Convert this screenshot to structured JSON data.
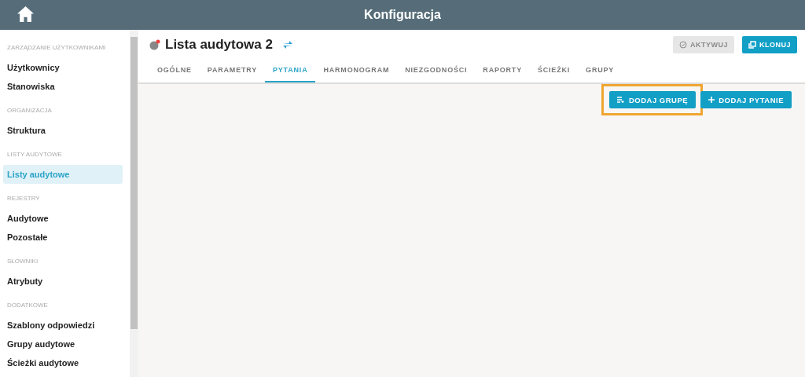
{
  "header": {
    "title": "Konfiguracja"
  },
  "sidebar": {
    "sections": [
      {
        "heading": "ZARZĄDZANIE UŻYTKOWNIKAMI",
        "items": [
          {
            "label": "Użytkownicy",
            "selected": false
          },
          {
            "label": "Stanowiska",
            "selected": false
          }
        ]
      },
      {
        "heading": "ORGANIZACJA",
        "items": [
          {
            "label": "Struktura",
            "selected": false
          }
        ]
      },
      {
        "heading": "LISTY AUDYTOWE",
        "items": [
          {
            "label": "Listy audytowe",
            "selected": true
          }
        ]
      },
      {
        "heading": "REJESTRY",
        "items": [
          {
            "label": "Audytowe",
            "selected": false
          },
          {
            "label": "Pozostałe",
            "selected": false
          }
        ]
      },
      {
        "heading": "SŁOWNIKI",
        "items": [
          {
            "label": "Atrybuty",
            "selected": false
          }
        ]
      },
      {
        "heading": "DODATKOWE",
        "items": [
          {
            "label": "Szablony odpowiedzi",
            "selected": false
          },
          {
            "label": "Grupy audytowe",
            "selected": false
          },
          {
            "label": "Ścieżki audytowe",
            "selected": false
          }
        ]
      }
    ]
  },
  "page": {
    "title": "Lista audytowa 2",
    "actions": [
      {
        "label": "AKTYWUJ",
        "kind": "activate",
        "disabled": true
      },
      {
        "label": "KLONUJ",
        "kind": "clone",
        "disabled": false
      }
    ]
  },
  "tabs": [
    {
      "label": "OGÓLNE",
      "selected": false
    },
    {
      "label": "PARAMETRY",
      "selected": false
    },
    {
      "label": "PYTANIA",
      "selected": true
    },
    {
      "label": "HARMONOGRAM",
      "selected": false
    },
    {
      "label": "NIEZGODNOŚCI",
      "selected": false
    },
    {
      "label": "RAPORTY",
      "selected": false
    },
    {
      "label": "ŚCIEŻKI",
      "selected": false
    },
    {
      "label": "GRUPY",
      "selected": false
    }
  ],
  "toolbar": [
    {
      "label": "DODAJ GRUPĘ",
      "kind": "add-group",
      "highlighted": true
    },
    {
      "label": "DODAJ PYTANIE",
      "kind": "add-question",
      "highlighted": false
    }
  ]
}
